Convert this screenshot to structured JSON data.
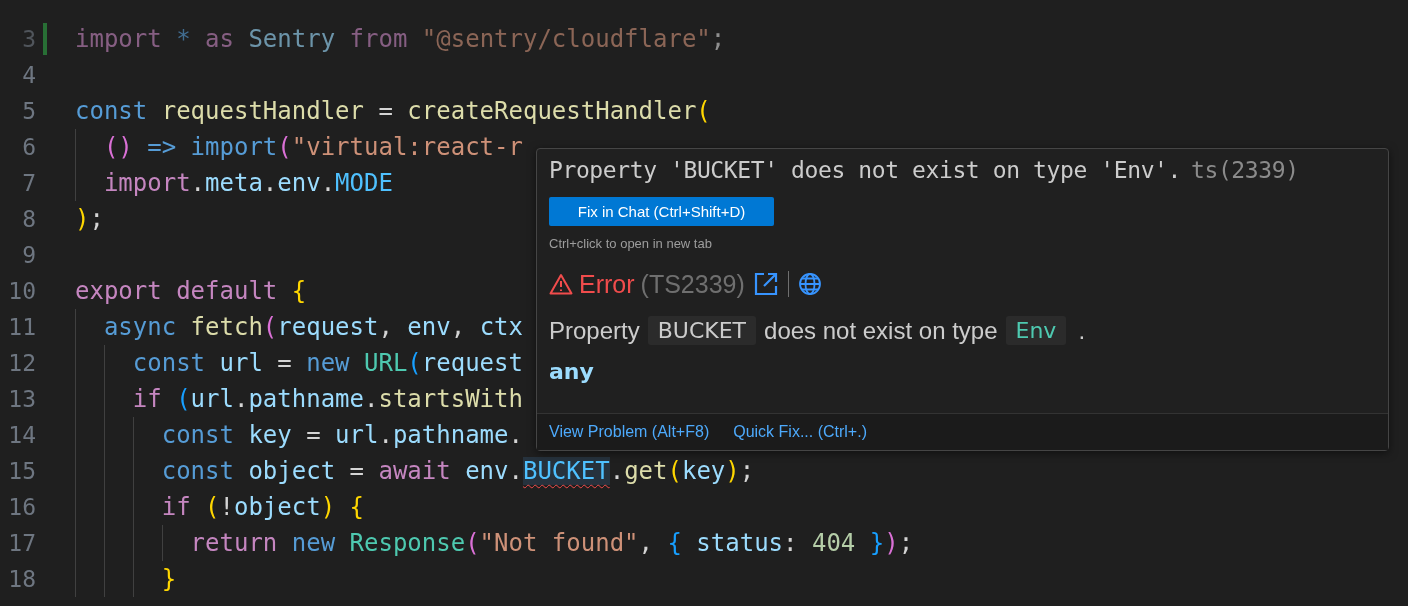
{
  "lines": [
    {
      "number": "3",
      "modified": true,
      "faded": true,
      "tokens": [
        {
          "text": "import ",
          "kind": "control"
        },
        {
          "text": "* ",
          "kind": "keyword"
        },
        {
          "text": "as ",
          "kind": "control"
        },
        {
          "text": "Sentry ",
          "kind": "var"
        },
        {
          "text": "from ",
          "kind": "control"
        },
        {
          "text": "\"@sentry/cloudflare\"",
          "kind": "string"
        },
        {
          "text": ";",
          "kind": "punct"
        }
      ]
    },
    {
      "number": "4",
      "modified": false,
      "faded": false
    },
    {
      "number": "5",
      "modified": false,
      "faded": false,
      "tokens": [
        {
          "text": "const ",
          "kind": "keyword"
        },
        {
          "text": "requestHandler ",
          "kind": "func"
        },
        {
          "text": "= ",
          "kind": "punct"
        },
        {
          "text": "createRequestHandler",
          "kind": "func"
        },
        {
          "text": "(",
          "kind": "brace1"
        }
      ]
    },
    {
      "number": "6",
      "modified": false,
      "faded": false,
      "tokens": [
        {
          "text": "  () ",
          "kind": "brace2"
        },
        {
          "text": "=> import",
          "kind": "keyword"
        },
        {
          "text": "(",
          "kind": "brace2"
        },
        {
          "text": "\"virtual:react-r",
          "kind": "string"
        }
      ]
    },
    {
      "number": "7",
      "modified": false,
      "faded": false,
      "tokens": [
        {
          "text": "  import",
          "kind": "control"
        },
        {
          "text": ".",
          "kind": "punct"
        },
        {
          "text": "meta",
          "kind": "var"
        },
        {
          "text": ".",
          "kind": "punct"
        },
        {
          "text": "env",
          "kind": "var"
        },
        {
          "text": ".",
          "kind": "punct"
        },
        {
          "text": "MODE",
          "kind": "constant"
        }
      ]
    },
    {
      "number": "8",
      "modified": false,
      "faded": false,
      "tokens": [
        {
          "text": ")",
          "kind": "brace1"
        },
        {
          "text": ";",
          "kind": "punct"
        }
      ]
    },
    {
      "number": "9",
      "modified": false,
      "faded": false
    },
    {
      "number": "10",
      "modified": false,
      "faded": false,
      "tokens": [
        {
          "text": "export ",
          "kind": "control"
        },
        {
          "text": "default ",
          "kind": "control"
        },
        {
          "text": "{",
          "kind": "brace1"
        }
      ]
    },
    {
      "number": "11",
      "modified": false,
      "faded": false,
      "tokens": [
        {
          "text": "  async ",
          "kind": "keyword"
        },
        {
          "text": "fetch",
          "kind": "func"
        },
        {
          "text": "(",
          "kind": "brace2"
        },
        {
          "text": "request",
          "kind": "var"
        },
        {
          "text": ", ",
          "kind": "punct"
        },
        {
          "text": "env",
          "kind": "var"
        },
        {
          "text": ", ",
          "kind": "punct"
        },
        {
          "text": "ctx",
          "kind": "var"
        }
      ]
    },
    {
      "number": "12",
      "modified": false,
      "faded": false,
      "tokens": [
        {
          "text": "    const ",
          "kind": "keyword"
        },
        {
          "text": "url ",
          "kind": "var"
        },
        {
          "text": "= ",
          "kind": "punct"
        },
        {
          "text": "new ",
          "kind": "keyword"
        },
        {
          "text": "URL",
          "kind": "type"
        },
        {
          "text": "(",
          "kind": "brace3"
        },
        {
          "text": "request",
          "kind": "var"
        }
      ]
    },
    {
      "number": "13",
      "modified": false,
      "faded": false,
      "tokens": [
        {
          "text": "    if ",
          "kind": "control"
        },
        {
          "text": "(",
          "kind": "brace3"
        },
        {
          "text": "url",
          "kind": "var"
        },
        {
          "text": ".",
          "kind": "punct"
        },
        {
          "text": "pathname",
          "kind": "var"
        },
        {
          "text": ".",
          "kind": "punct"
        },
        {
          "text": "startsWith",
          "kind": "func"
        }
      ]
    },
    {
      "number": "14",
      "modified": false,
      "faded": false,
      "tokens": [
        {
          "text": "      const ",
          "kind": "keyword"
        },
        {
          "text": "key ",
          "kind": "var"
        },
        {
          "text": "= ",
          "kind": "punct"
        },
        {
          "text": "url",
          "kind": "var"
        },
        {
          "text": ".",
          "kind": "punct"
        },
        {
          "text": "pathname",
          "kind": "var"
        },
        {
          "text": ".",
          "kind": "punct"
        }
      ]
    },
    {
      "number": "15",
      "modified": false,
      "faded": false,
      "tokens": [
        {
          "text": "      const ",
          "kind": "keyword"
        },
        {
          "text": "object ",
          "kind": "var"
        },
        {
          "text": "= ",
          "kind": "punct"
        },
        {
          "text": "await ",
          "kind": "control"
        },
        {
          "text": "env",
          "kind": "var"
        },
        {
          "text": ".",
          "kind": "punct"
        },
        {
          "text": "BUCKET",
          "kind": "error"
        },
        {
          "text": ".",
          "kind": "punct"
        },
        {
          "text": "get",
          "kind": "func"
        },
        {
          "text": "(",
          "kind": "brace1"
        },
        {
          "text": "key",
          "kind": "var"
        },
        {
          "text": ")",
          "kind": "brace1"
        },
        {
          "text": ";",
          "kind": "punct"
        }
      ]
    },
    {
      "number": "16",
      "modified": false,
      "faded": false,
      "tokens": [
        {
          "text": "      if ",
          "kind": "control"
        },
        {
          "text": "(",
          "kind": "brace1"
        },
        {
          "text": "!",
          "kind": "punct"
        },
        {
          "text": "object",
          "kind": "var"
        },
        {
          "text": ") ",
          "kind": "brace1"
        },
        {
          "text": "{",
          "kind": "brace1"
        }
      ]
    },
    {
      "number": "17",
      "modified": false,
      "faded": false,
      "tokens": [
        {
          "text": "        return ",
          "kind": "control"
        },
        {
          "text": "new ",
          "kind": "keyword"
        },
        {
          "text": "Response",
          "kind": "type"
        },
        {
          "text": "(",
          "kind": "brace2"
        },
        {
          "text": "\"Not found\"",
          "kind": "string"
        },
        {
          "text": ", ",
          "kind": "punct"
        },
        {
          "text": "{ ",
          "kind": "brace3"
        },
        {
          "text": "status",
          "kind": "var"
        },
        {
          "text": ": ",
          "kind": "punct"
        },
        {
          "text": "404 ",
          "kind": "number"
        },
        {
          "text": "}",
          "kind": "brace3"
        },
        {
          "text": ")",
          "kind": "brace2"
        },
        {
          "text": ";",
          "kind": "punct"
        }
      ]
    },
    {
      "number": "18",
      "modified": false,
      "faded": false,
      "tokens": [
        {
          "text": "      }",
          "kind": "brace1"
        }
      ]
    }
  ],
  "hover": {
    "title": "Property 'BUCKET' does not exist on type 'Env'.",
    "source": "ts(2339)",
    "fix_button": "Fix in Chat (Ctrl+Shift+D)",
    "hint": "Ctrl+click to open in new tab",
    "severity": "Error",
    "error_code": "(TS2339)",
    "message": [
      {
        "text": "Property",
        "kind": "text"
      },
      {
        "text": "BUCKET",
        "kind": "code"
      },
      {
        "text": "does not exist on type",
        "kind": "text"
      },
      {
        "text": "Env",
        "kind": "type"
      },
      {
        "text": ".",
        "kind": "text"
      }
    ],
    "type": "any",
    "actions": [
      "View Problem (Alt+F8)",
      "Quick Fix... (Ctrl+.)"
    ]
  }
}
